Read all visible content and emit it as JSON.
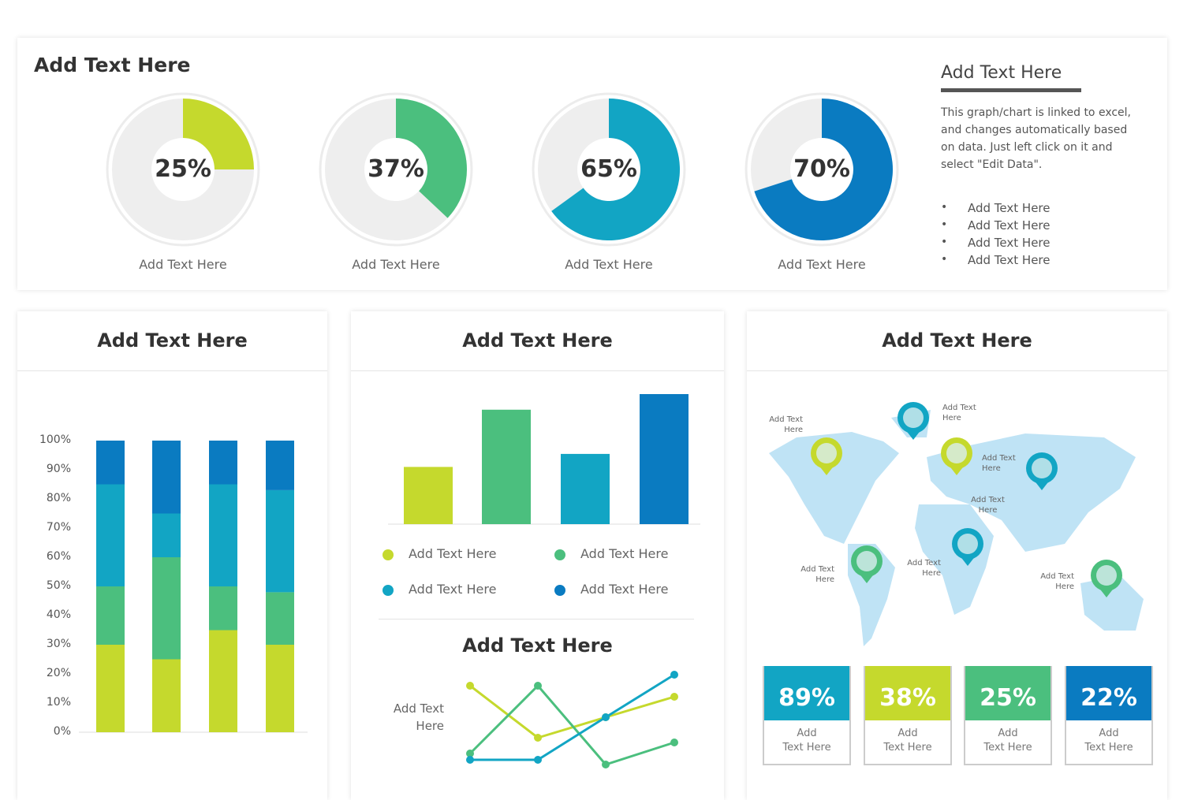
{
  "colors": {
    "lime": "#c5d92d",
    "green": "#4bbf7e",
    "teal": "#12a5c4",
    "blue": "#0a7bc1",
    "ring": "#eeeeee"
  },
  "top": {
    "title": "Add Text Here",
    "donuts": [
      {
        "value": 25,
        "label": "25%",
        "caption": "Add Text Here",
        "color": "#c5d92d"
      },
      {
        "value": 37,
        "label": "37%",
        "caption": "Add Text Here",
        "color": "#4bbf7e"
      },
      {
        "value": 65,
        "label": "65%",
        "caption": "Add Text Here",
        "color": "#12a5c4"
      },
      {
        "value": 70,
        "label": "70%",
        "caption": "Add Text Here",
        "color": "#0a7bc1"
      }
    ],
    "side": {
      "title": "Add Text Here",
      "body": "This graph/chart is linked to excel, and changes automatically based on data. Just left click on it and select \"Edit Data\".",
      "bullets": [
        "Add Text Here",
        "Add Text Here",
        "Add Text Here",
        "Add Text Here"
      ]
    }
  },
  "panels": {
    "left_title": "Add Text Here",
    "mid_title": "Add Text Here",
    "mid_sub_title": "Add Text Here",
    "right_title": "Add Text Here"
  },
  "chart_data": [
    {
      "type": "bar",
      "stacked": true,
      "ylim": [
        0,
        100
      ],
      "yticks": [
        "0%",
        "10%",
        "20%",
        "30%",
        "40%",
        "50%",
        "60%",
        "70%",
        "80%",
        "90%",
        "100%"
      ],
      "series": [
        {
          "values": [
            30,
            25,
            35,
            30
          ],
          "color": "#c5d92d"
        },
        {
          "values": [
            20,
            35,
            15,
            18
          ],
          "color": "#4bbf7e"
        },
        {
          "values": [
            35,
            15,
            35,
            35
          ],
          "color": "#12a5c4"
        },
        {
          "values": [
            15,
            25,
            15,
            17
          ],
          "color": "#0a7bc1"
        }
      ]
    },
    {
      "type": "bar",
      "values": [
        2.2,
        4.4,
        2.7,
        5.0
      ],
      "colors": [
        "#c5d92d",
        "#4bbf7e",
        "#12a5c4",
        "#0a7bc1"
      ],
      "legend": [
        {
          "label": "Add Text Here",
          "color": "#c5d92d"
        },
        {
          "label": "Add Text Here",
          "color": "#4bbf7e"
        },
        {
          "label": "Add Text Here",
          "color": "#12a5c4"
        },
        {
          "label": "Add Text Here",
          "color": "#0a7bc1"
        }
      ]
    },
    {
      "type": "line",
      "ylabel": "Add Text Here",
      "series": [
        {
          "values": [
            5.5,
            2.2,
            3.5,
            4.8
          ],
          "color": "#c5d92d"
        },
        {
          "values": [
            1.2,
            5.5,
            0.5,
            1.9
          ],
          "color": "#4bbf7e"
        },
        {
          "values": [
            0.8,
            0.8,
            3.5,
            6.2
          ],
          "color": "#12a5c4"
        }
      ]
    }
  ],
  "map": {
    "pins": [
      {
        "label": "Add Text Here",
        "color": "#c5d92d"
      },
      {
        "label": "Add Text Here",
        "color": "#12a5c4"
      },
      {
        "label": "Add Text Here",
        "color": "#c5d92d"
      },
      {
        "label": "Add Text Here",
        "color": "#12a5c4"
      },
      {
        "label": "Add Text Here",
        "color": "#4bbf7e"
      },
      {
        "label": "Add Text Here",
        "color": "#12a5c4"
      },
      {
        "label": "Add Text Here",
        "color": "#4bbf7e"
      }
    ],
    "extra_label": "Add Text Here"
  },
  "kpis": [
    {
      "value": "89%",
      "label": "Add\nText Here",
      "color": "#12a5c4"
    },
    {
      "value": "38%",
      "label": "Add\nText Here",
      "color": "#c5d92d"
    },
    {
      "value": "25%",
      "label": "Add\nText Here",
      "color": "#4bbf7e"
    },
    {
      "value": "22%",
      "label": "Add\nText Here",
      "color": "#0a7bc1"
    }
  ]
}
